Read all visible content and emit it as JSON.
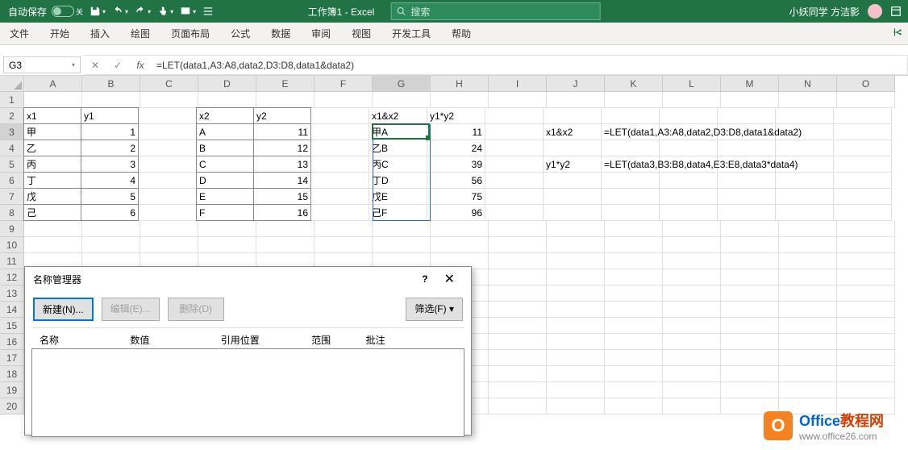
{
  "titlebar": {
    "autosave": "自动保存",
    "autosave_state": "关",
    "doc": "工作簿1 - Excel",
    "search_placeholder": "搜索",
    "user": "小妖同学 方洁影"
  },
  "ribbon": {
    "tabs": [
      "文件",
      "开始",
      "插入",
      "绘图",
      "页面布局",
      "公式",
      "数据",
      "审阅",
      "视图",
      "开发工具",
      "帮助"
    ]
  },
  "formulabar": {
    "namebox": "G3",
    "formula": "=LET(data1,A3:A8,data2,D3:D8,data1&data2)"
  },
  "columns": [
    "A",
    "B",
    "C",
    "D",
    "E",
    "F",
    "G",
    "H",
    "I",
    "J",
    "K",
    "L",
    "M",
    "N",
    "O"
  ],
  "rows": 20,
  "cells": {
    "A2": "x1",
    "B2": "y1",
    "A3": "甲",
    "B3": "1",
    "A4": "乙",
    "B4": "2",
    "A5": "丙",
    "B5": "3",
    "A6": "丁",
    "B6": "4",
    "A7": "戊",
    "B7": "5",
    "A8": "己",
    "B8": "6",
    "D2": "x2",
    "E2": "y2",
    "D3": "A",
    "E3": "11",
    "D4": "B",
    "E4": "12",
    "D5": "C",
    "E5": "13",
    "D6": "D",
    "E6": "14",
    "D7": "E",
    "E7": "15",
    "D8": "F",
    "E8": "16",
    "G2": "x1&x2",
    "H2": "y1*y2",
    "G3": "甲A",
    "H3": "11",
    "G4": "乙B",
    "H4": "24",
    "G5": "丙C",
    "H5": "39",
    "G6": "丁D",
    "H6": "56",
    "G7": "戊E",
    "H7": "75",
    "G8": "己F",
    "H8": "96",
    "J3": "x1&x2",
    "K3": "=LET(data1,A3:A8,data2,D3:D8,data1&data2)",
    "J5": "y1*y2",
    "K5": "=LET(data3,B3:B8,data4,E3:E8,data3*data4)"
  },
  "bordered_ranges": [
    [
      "A2",
      "B8"
    ],
    [
      "D2",
      "E8"
    ]
  ],
  "right_align": [
    "B3",
    "B4",
    "B5",
    "B6",
    "B7",
    "B8",
    "E3",
    "E4",
    "E5",
    "E6",
    "E7",
    "E8",
    "H3",
    "H4",
    "H5",
    "H6",
    "H7",
    "H8"
  ],
  "overflow_cells": [
    "K3",
    "K5"
  ],
  "active_cell": "G3",
  "spill": {
    "from": "G3",
    "to": "G8"
  },
  "dialog": {
    "title": "名称管理器",
    "btn_new": "新建(N)...",
    "btn_edit": "编辑(E)...",
    "btn_delete": "删除(D)",
    "btn_filter": "筛选(F)",
    "cols": [
      "名称",
      "数值",
      "引用位置",
      "范围",
      "批注"
    ]
  },
  "watermark": {
    "brand1": "Office",
    "brand2": "教程网",
    "url": "www.office26.com"
  }
}
